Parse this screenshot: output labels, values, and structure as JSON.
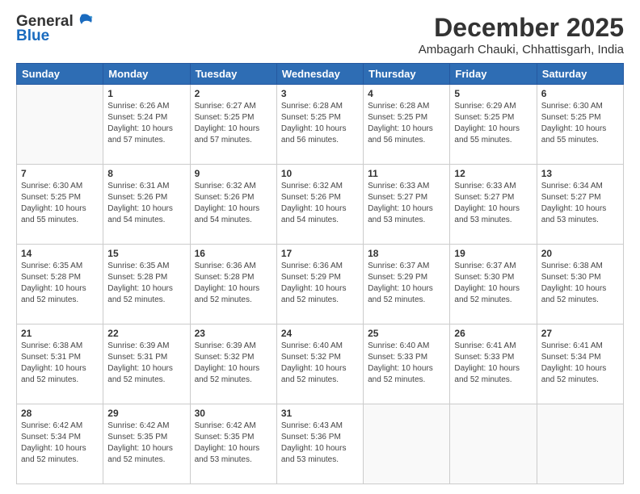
{
  "header": {
    "logo_general": "General",
    "logo_blue": "Blue",
    "month_title": "December 2025",
    "subtitle": "Ambagarh Chauki, Chhattisgarh, India"
  },
  "weekdays": [
    "Sunday",
    "Monday",
    "Tuesday",
    "Wednesday",
    "Thursday",
    "Friday",
    "Saturday"
  ],
  "weeks": [
    [
      {
        "day": "",
        "info": ""
      },
      {
        "day": "1",
        "info": "Sunrise: 6:26 AM\nSunset: 5:24 PM\nDaylight: 10 hours\nand 57 minutes."
      },
      {
        "day": "2",
        "info": "Sunrise: 6:27 AM\nSunset: 5:25 PM\nDaylight: 10 hours\nand 57 minutes."
      },
      {
        "day": "3",
        "info": "Sunrise: 6:28 AM\nSunset: 5:25 PM\nDaylight: 10 hours\nand 56 minutes."
      },
      {
        "day": "4",
        "info": "Sunrise: 6:28 AM\nSunset: 5:25 PM\nDaylight: 10 hours\nand 56 minutes."
      },
      {
        "day": "5",
        "info": "Sunrise: 6:29 AM\nSunset: 5:25 PM\nDaylight: 10 hours\nand 55 minutes."
      },
      {
        "day": "6",
        "info": "Sunrise: 6:30 AM\nSunset: 5:25 PM\nDaylight: 10 hours\nand 55 minutes."
      }
    ],
    [
      {
        "day": "7",
        "info": "Sunrise: 6:30 AM\nSunset: 5:25 PM\nDaylight: 10 hours\nand 55 minutes."
      },
      {
        "day": "8",
        "info": "Sunrise: 6:31 AM\nSunset: 5:26 PM\nDaylight: 10 hours\nand 54 minutes."
      },
      {
        "day": "9",
        "info": "Sunrise: 6:32 AM\nSunset: 5:26 PM\nDaylight: 10 hours\nand 54 minutes."
      },
      {
        "day": "10",
        "info": "Sunrise: 6:32 AM\nSunset: 5:26 PM\nDaylight: 10 hours\nand 54 minutes."
      },
      {
        "day": "11",
        "info": "Sunrise: 6:33 AM\nSunset: 5:27 PM\nDaylight: 10 hours\nand 53 minutes."
      },
      {
        "day": "12",
        "info": "Sunrise: 6:33 AM\nSunset: 5:27 PM\nDaylight: 10 hours\nand 53 minutes."
      },
      {
        "day": "13",
        "info": "Sunrise: 6:34 AM\nSunset: 5:27 PM\nDaylight: 10 hours\nand 53 minutes."
      }
    ],
    [
      {
        "day": "14",
        "info": "Sunrise: 6:35 AM\nSunset: 5:28 PM\nDaylight: 10 hours\nand 52 minutes."
      },
      {
        "day": "15",
        "info": "Sunrise: 6:35 AM\nSunset: 5:28 PM\nDaylight: 10 hours\nand 52 minutes."
      },
      {
        "day": "16",
        "info": "Sunrise: 6:36 AM\nSunset: 5:28 PM\nDaylight: 10 hours\nand 52 minutes."
      },
      {
        "day": "17",
        "info": "Sunrise: 6:36 AM\nSunset: 5:29 PM\nDaylight: 10 hours\nand 52 minutes."
      },
      {
        "day": "18",
        "info": "Sunrise: 6:37 AM\nSunset: 5:29 PM\nDaylight: 10 hours\nand 52 minutes."
      },
      {
        "day": "19",
        "info": "Sunrise: 6:37 AM\nSunset: 5:30 PM\nDaylight: 10 hours\nand 52 minutes."
      },
      {
        "day": "20",
        "info": "Sunrise: 6:38 AM\nSunset: 5:30 PM\nDaylight: 10 hours\nand 52 minutes."
      }
    ],
    [
      {
        "day": "21",
        "info": "Sunrise: 6:38 AM\nSunset: 5:31 PM\nDaylight: 10 hours\nand 52 minutes."
      },
      {
        "day": "22",
        "info": "Sunrise: 6:39 AM\nSunset: 5:31 PM\nDaylight: 10 hours\nand 52 minutes."
      },
      {
        "day": "23",
        "info": "Sunrise: 6:39 AM\nSunset: 5:32 PM\nDaylight: 10 hours\nand 52 minutes."
      },
      {
        "day": "24",
        "info": "Sunrise: 6:40 AM\nSunset: 5:32 PM\nDaylight: 10 hours\nand 52 minutes."
      },
      {
        "day": "25",
        "info": "Sunrise: 6:40 AM\nSunset: 5:33 PM\nDaylight: 10 hours\nand 52 minutes."
      },
      {
        "day": "26",
        "info": "Sunrise: 6:41 AM\nSunset: 5:33 PM\nDaylight: 10 hours\nand 52 minutes."
      },
      {
        "day": "27",
        "info": "Sunrise: 6:41 AM\nSunset: 5:34 PM\nDaylight: 10 hours\nand 52 minutes."
      }
    ],
    [
      {
        "day": "28",
        "info": "Sunrise: 6:42 AM\nSunset: 5:34 PM\nDaylight: 10 hours\nand 52 minutes."
      },
      {
        "day": "29",
        "info": "Sunrise: 6:42 AM\nSunset: 5:35 PM\nDaylight: 10 hours\nand 52 minutes."
      },
      {
        "day": "30",
        "info": "Sunrise: 6:42 AM\nSunset: 5:35 PM\nDaylight: 10 hours\nand 53 minutes."
      },
      {
        "day": "31",
        "info": "Sunrise: 6:43 AM\nSunset: 5:36 PM\nDaylight: 10 hours\nand 53 minutes."
      },
      {
        "day": "",
        "info": ""
      },
      {
        "day": "",
        "info": ""
      },
      {
        "day": "",
        "info": ""
      }
    ]
  ]
}
